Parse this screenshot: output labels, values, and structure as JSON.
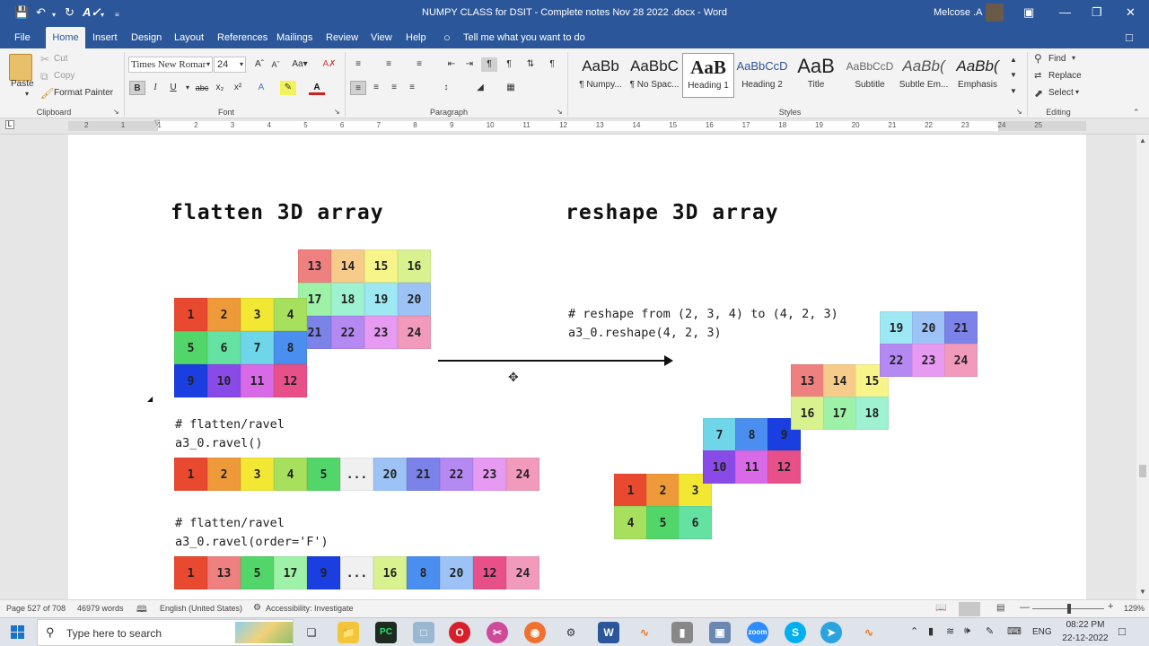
{
  "titlebar": {
    "title": "NUMPY CLASS for DSIT - Complete notes Nov 28 2022 .docx  -  Word",
    "user": "Melcose .A",
    "bg_color": "#2b579a"
  },
  "menu": {
    "tabs": [
      "File",
      "Home",
      "Insert",
      "Design",
      "Layout",
      "References",
      "Mailings",
      "Review",
      "View",
      "Help"
    ],
    "active_tab": "Home",
    "tell_me": "Tell me what you want to do"
  },
  "ribbon": {
    "clipboard": {
      "paste": "Paste",
      "cut": "Cut",
      "copy": "Copy",
      "format_painter": "Format Painter",
      "label": "Clipboard"
    },
    "font": {
      "family": "Times New Romar",
      "size": "24",
      "label": "Font"
    },
    "paragraph": {
      "label": "Paragraph"
    },
    "styles": {
      "label": "Styles",
      "items": [
        {
          "preview": "AaBb",
          "name": "¶ Numpy..."
        },
        {
          "preview": "AaBbC",
          "name": "¶ No Spac..."
        },
        {
          "preview": "AaB",
          "name": "Heading 1"
        },
        {
          "preview": "AaBbCcD",
          "name": "Heading 2"
        },
        {
          "preview": "AaB",
          "name": "Title"
        },
        {
          "preview": "AaBbCcD",
          "name": "Subtitle"
        },
        {
          "preview": "AaBb(",
          "name": "Subtle Em..."
        },
        {
          "preview": "AaBb(",
          "name": "Emphasis"
        }
      ]
    },
    "editing": {
      "find": "Find",
      "replace": "Replace",
      "select": "Select",
      "label": "Editing"
    }
  },
  "ruler": {
    "numbers": [
      "2",
      "1",
      "1",
      "2",
      "3",
      "4",
      "5",
      "6",
      "7",
      "8",
      "9",
      "10",
      "11",
      "12",
      "13",
      "14",
      "15",
      "16",
      "17",
      "18",
      "19",
      "20",
      "21",
      "22",
      "23",
      "24",
      "25"
    ]
  },
  "document": {
    "heading_left": "flatten 3D array",
    "heading_right": "reshape 3D array",
    "code_reshape_comment": "# reshape from (2, 3, 4) to (4, 2, 3)",
    "code_reshape_call": "a3_0.reshape(4, 2, 3)",
    "code_ravel_comment": "# flatten/ravel",
    "code_ravel_call": "a3_0.ravel()",
    "code_ravelF_comment": "# flatten/ravel",
    "code_ravelF_call": "a3_0.ravel(order='F')",
    "cube_front": [
      "1",
      "2",
      "3",
      "4",
      "5",
      "6",
      "7",
      "8",
      "9",
      "10",
      "11",
      "12"
    ],
    "cube_back": [
      "13",
      "14",
      "15",
      "16",
      "17",
      "18",
      "19",
      "20",
      "21",
      "22",
      "23",
      "24"
    ],
    "ravel_c": [
      "1",
      "2",
      "3",
      "4",
      "5",
      "...",
      "20",
      "21",
      "22",
      "23",
      "24"
    ],
    "ravel_f": [
      "1",
      "13",
      "5",
      "17",
      "9",
      "...",
      "16",
      "8",
      "20",
      "12",
      "24"
    ],
    "reshape_blocks": [
      [
        "1",
        "2",
        "3",
        "4",
        "5",
        "6"
      ],
      [
        "7",
        "8",
        "9",
        "10",
        "11",
        "12"
      ],
      [
        "13",
        "14",
        "15",
        "16",
        "17",
        "18"
      ],
      [
        "19",
        "20",
        "21",
        "22",
        "23",
        "24"
      ]
    ]
  },
  "colors": {
    "1": "#e8492f",
    "2": "#ef9a3a",
    "3": "#f2e834",
    "4": "#a6e05c",
    "5": "#52d66a",
    "6": "#64e2a2",
    "7": "#6fd6ea",
    "8": "#4a8ff0",
    "9": "#1a3ee0",
    "10": "#8a4ae8",
    "11": "#d86ae8",
    "12": "#e8508a",
    "13": "#ef8080",
    "14": "#f7cc8a",
    "15": "#f7f48a",
    "16": "#d9f290",
    "17": "#9ef2a8",
    "18": "#9ef2d2",
    "19": "#9ee8f4",
    "20": "#9cc2f6",
    "21": "#7b82e8",
    "22": "#b48af2",
    "23": "#e69af2",
    "24": "#f29abc",
    "...": "#f0f0f0"
  },
  "statusbar": {
    "page": "Page 527 of 708",
    "words": "46979 words",
    "language": "English (United States)",
    "accessibility": "Accessibility: Investigate",
    "zoom": "129%"
  },
  "taskbar": {
    "search_placeholder": "Type here to search",
    "lang": "ENG",
    "time": "08:22 PM",
    "date": "22-12-2022"
  }
}
